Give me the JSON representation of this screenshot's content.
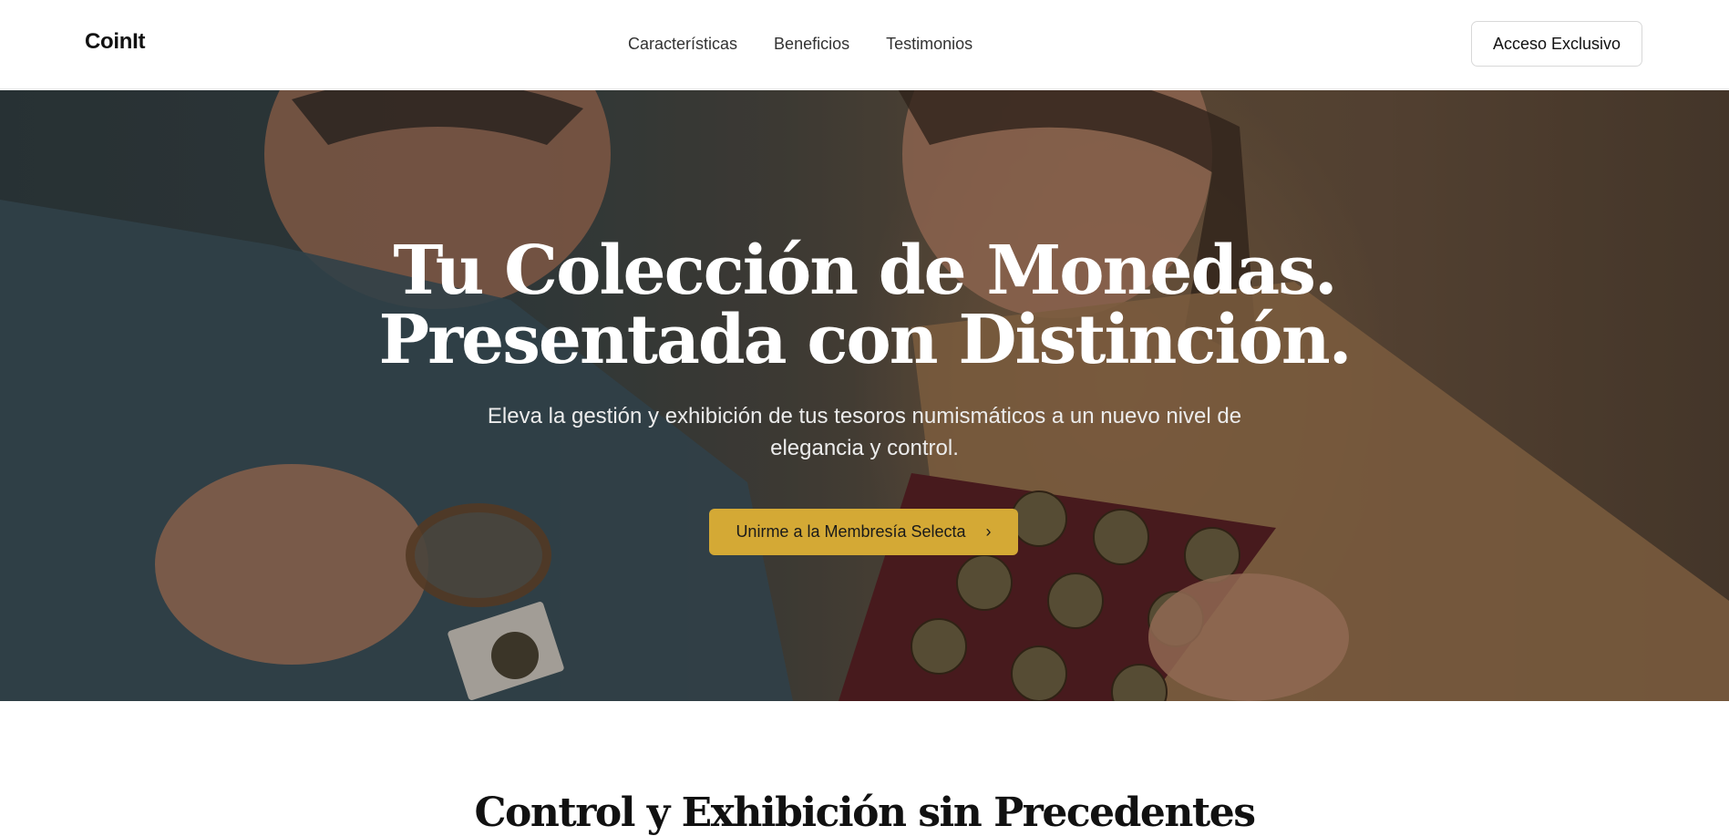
{
  "header": {
    "brand": "CoinIt",
    "nav": [
      "Características",
      "Beneficios",
      "Testimonios"
    ],
    "access_button": "Acceso Exclusivo"
  },
  "hero": {
    "title_line1": "Tu Colección de Monedas.",
    "title_line2": "Presentada con Distinción.",
    "subtitle": "Eleva la gestión y exhibición de tus tesoros numismáticos a un nuevo nivel de elegancia y control.",
    "cta_label": "Unirme a la Membresía Selecta",
    "cta_icon": "chevron-right-icon"
  },
  "features": {
    "title": "Control y Exhibición sin Precedentes"
  },
  "colors": {
    "accent": "#d4a935",
    "header_bg": "#ffffff",
    "hero_text": "#ffffff"
  }
}
